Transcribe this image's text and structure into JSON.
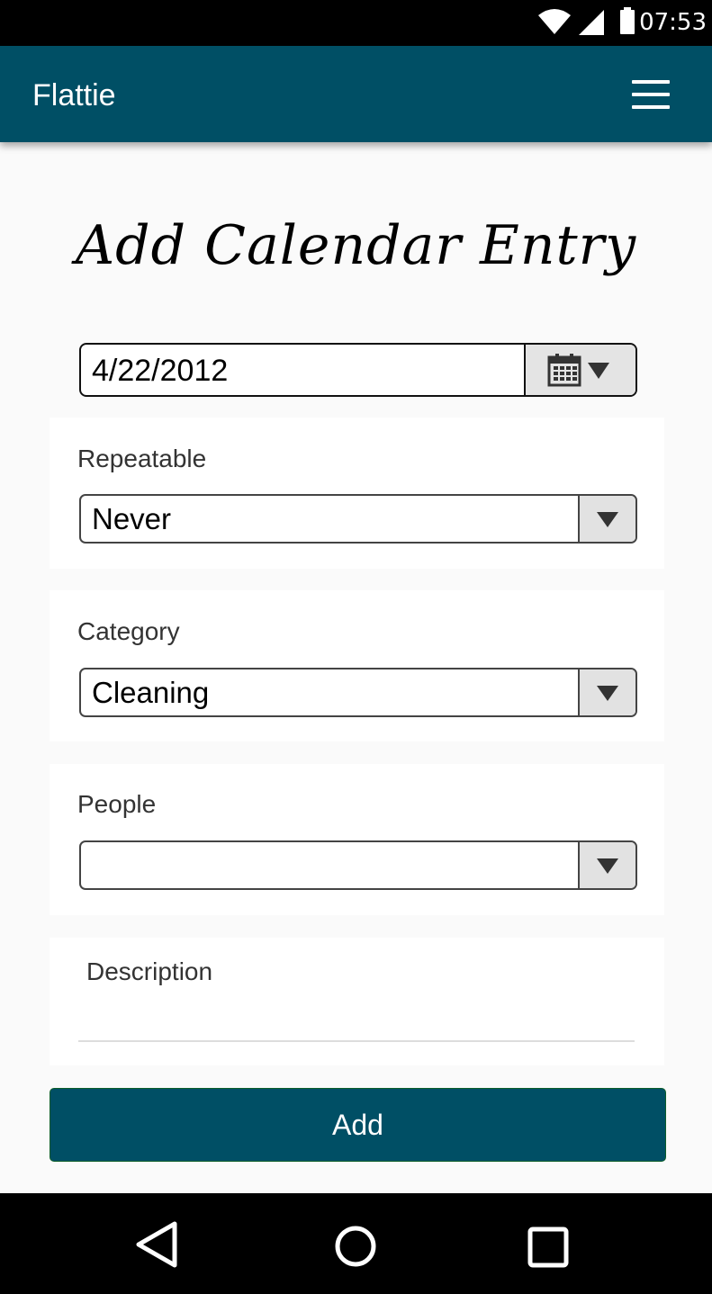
{
  "status_bar": {
    "time": "07:53"
  },
  "app_bar": {
    "title": "Flattie"
  },
  "page": {
    "heading": "Add Calendar Entry"
  },
  "date_field": {
    "value": "4/22/2012"
  },
  "repeatable": {
    "label": "Repeatable",
    "value": "Never"
  },
  "category": {
    "label": "Category",
    "value": "Cleaning"
  },
  "people": {
    "label": "People",
    "value": ""
  },
  "description": {
    "placeholder": "Description"
  },
  "add_button": {
    "label": "Add"
  },
  "colors": {
    "primary": "#004f65",
    "background": "#fafafa"
  },
  "icons": [
    "wifi-icon",
    "signal-icon",
    "battery-icon",
    "menu-icon",
    "calendar-icon",
    "back-icon",
    "home-icon",
    "recents-icon"
  ]
}
